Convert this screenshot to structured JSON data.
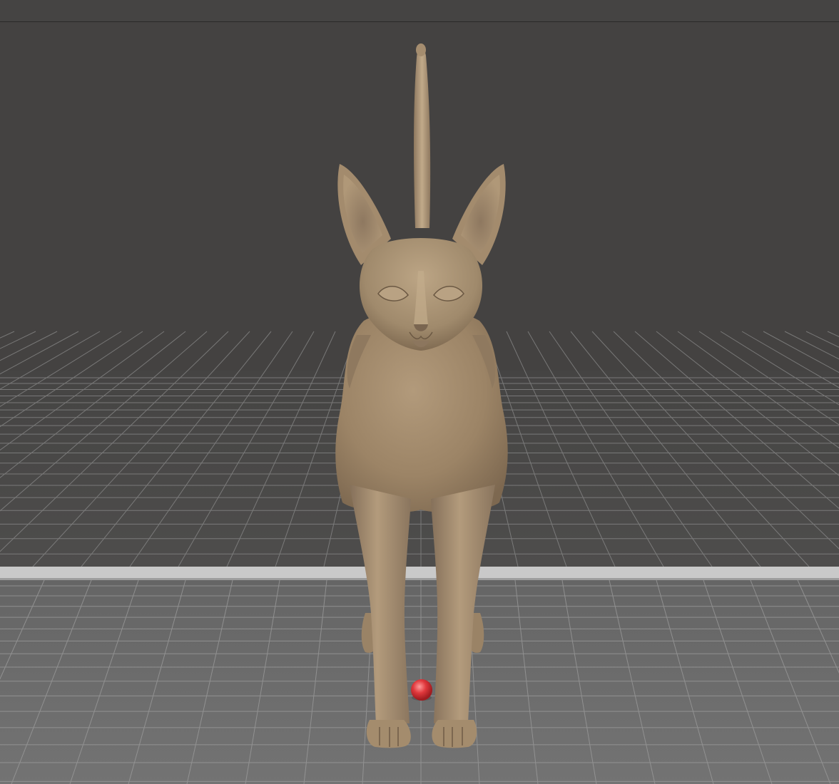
{
  "viewport": {
    "mode": "3d-perspective-view",
    "background_color": "#444241",
    "grid_line_color": "#8a8a8a",
    "floor_color": "#6a6a6a",
    "horizon_strip_color": "#c9c9c9"
  },
  "scene": {
    "model": "hairless-cat-sculpt",
    "model_color": "#a28a6c",
    "marker_icon": "red-sphere-marker",
    "marker_color": "#e0383c"
  }
}
